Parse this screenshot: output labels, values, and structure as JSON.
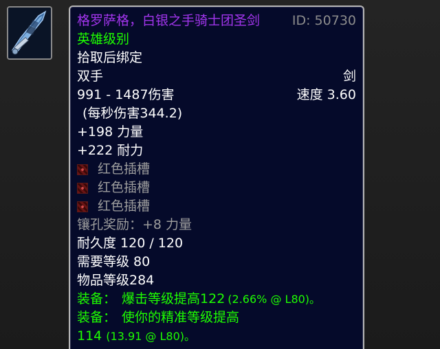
{
  "icon": {
    "name": "two-handed-sword-icon"
  },
  "tooltip": {
    "item_name": "格罗萨格，白银之手骑士团圣剑",
    "item_id": "ID: 50730",
    "quality": "英雄级别",
    "bind": "拾取后绑定",
    "hand": "双手",
    "weapon_type": "剑",
    "damage": "991 - 1487伤害",
    "speed": "速度 3.60",
    "dps": "(每秒伤害344.2)",
    "stat_strength": "+198 力量",
    "stat_stamina": "+222 耐力",
    "sockets": [
      {
        "label": "红色插槽",
        "color": "#c43b3b"
      },
      {
        "label": "红色插槽",
        "color": "#c43b3b"
      },
      {
        "label": "红色插槽",
        "color": "#c43b3b"
      }
    ],
    "socket_bonus": "镶孔奖励：+8 力量",
    "durability": "耐久度 120 / 120",
    "required_level": "需要等级 80",
    "item_level": "物品等级284",
    "equip1_prefix": "装备：",
    "equip1_text": "爆击等级提高122",
    "equip1_note": "(2.66% @ L80)。",
    "equip2_prefix": "装备：",
    "equip2_text": "使你的精准等级提高",
    "equip2_value": "114",
    "equip2_note": "(13.91 @ L80)。"
  },
  "colors": {
    "epic_purple": "#a335ee",
    "uncommon_green": "#1eff00",
    "socket_gray": "#9d9d9d",
    "tooltip_bg": "#050a2a",
    "white": "#ffffff"
  }
}
